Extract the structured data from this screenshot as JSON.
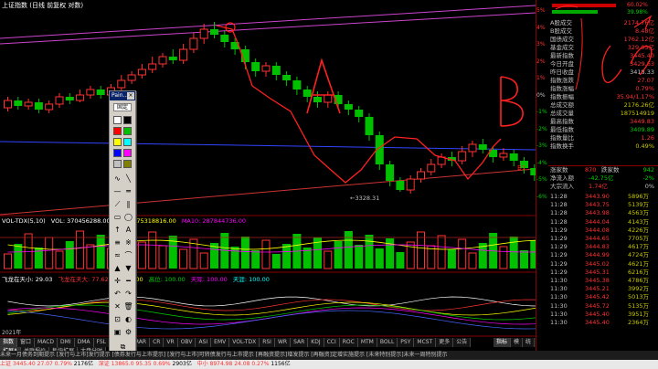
{
  "chart": {
    "title": "上证指数 (日线 前复权 对数)",
    "low_annotation": "←3328.31",
    "vol_legend": {
      "name": "VOL-TDX(5,10)",
      "vol": "VOL: 370456288.00",
      "ma5": "MA5: 275318816.00",
      "ma10": "MA10: 287844736.00"
    },
    "ind_legend": {
      "name": "飞龙在天",
      "a": "飞龙在天小: 29.03",
      "b": "飞龙在天大: 77.62",
      "c": "海底: 0.00",
      "d": "高位: 100.00",
      "e": "天际: 100.00",
      "f": "天涯: 100.00"
    },
    "date_label": "2021年"
  },
  "tabs_row1": [
    "指数",
    "窗口",
    "MACD",
    "DMI",
    "DMA",
    "FSL",
    "TRIX",
    "BRAR",
    "CR",
    "VR",
    "OBV",
    "ASI",
    "EMV",
    "VOL-TDX",
    "RSI",
    "WR",
    "SAR",
    "KDJ",
    "CCI",
    "ROC",
    "MTM",
    "BOLL",
    "PSY",
    "MCST",
    "更多",
    "公告"
  ],
  "tabs_row2": [
    "扩展A",
    "关联报价",
    "板块扩展",
    "大盘分时"
  ],
  "right_tabs": [
    "指标",
    "模",
    "统",
    "+"
  ],
  "percent_scale": [
    "5%",
    "4%",
    "3%",
    "2%",
    "1%",
    "0%",
    "-1%",
    "-2%",
    "-3%",
    "-4%",
    "-5%",
    "-6%"
  ],
  "top_bars": {
    "v1": "60.02%",
    "v2": "39.98%"
  },
  "market_stats": [
    {
      "label": "A股成交",
      "value": "2174.76亿",
      "color": "#ff3333"
    },
    {
      "label": "B股成交",
      "value": "8.48亿",
      "color": "#ff3333"
    },
    {
      "label": "国债成交",
      "value": "1762.12亿",
      "color": "#ff3333"
    },
    {
      "label": "基金成交",
      "value": "329.03亿",
      "color": "#ff3333"
    },
    {
      "label": "最新指数",
      "value": "3445.40",
      "color": "#ff3333"
    },
    {
      "label": "今日开盘",
      "value": "3429.63",
      "color": "#ff3333"
    },
    {
      "label": "昨日收盘",
      "value": "3418.33",
      "color": "#c0c0c0"
    },
    {
      "label": "指数涨跌",
      "value": "27.07",
      "color": "#ff3333"
    },
    {
      "label": "指数涨幅",
      "value": "0.79%",
      "color": "#ff3333"
    },
    {
      "label": "指数振幅",
      "value": "35.94/1.17%",
      "color": "#ff3333"
    },
    {
      "label": "总成交额",
      "value": "2176.26亿",
      "color": "#c8c800"
    },
    {
      "label": "总成交量",
      "value": "187514919",
      "color": "#c8c800"
    },
    {
      "label": "最高指数",
      "value": "3449.83",
      "color": "#ff3333"
    },
    {
      "label": "最低指数",
      "value": "3409.89",
      "color": "#00d000"
    },
    {
      "label": "指数量比",
      "value": "1.26",
      "color": "#ff3333"
    },
    {
      "label": "指数换手",
      "value": "0.49%",
      "color": "#c8c800"
    }
  ],
  "updown": {
    "up_label": "涨家数",
    "up": "870",
    "down_label": "跌家数",
    "down": "942"
  },
  "flow": [
    {
      "label": "净流入额",
      "value": "-42.75亿",
      "pct": "-2%"
    },
    {
      "label": "大宗流入",
      "value": "1.74亿",
      "pct": "0%"
    }
  ],
  "ticks": [
    {
      "t": "11:28",
      "p": "3443.90",
      "v": "5896万"
    },
    {
      "t": "11:28",
      "p": "3443.75",
      "v": "5139万"
    },
    {
      "t": "11:28",
      "p": "3443.98",
      "v": "4563万"
    },
    {
      "t": "11:28",
      "p": "3444.04",
      "v": "4143万"
    },
    {
      "t": "11:29",
      "p": "3444.08",
      "v": "4226万"
    },
    {
      "t": "11:29",
      "p": "3444.65",
      "v": "7705万"
    },
    {
      "t": "11:29",
      "p": "3444.83",
      "v": "4617万"
    },
    {
      "t": "11:29",
      "p": "3444.99",
      "v": "4724万"
    },
    {
      "t": "11:29",
      "p": "3445.02",
      "v": "4621万"
    },
    {
      "t": "11:29",
      "p": "3445.31",
      "v": "6216万"
    },
    {
      "t": "11:30",
      "p": "3445.38",
      "v": "4786万"
    },
    {
      "t": "11:30",
      "p": "3445.21",
      "v": "3992万"
    },
    {
      "t": "11:30",
      "p": "3445.42",
      "v": "5013万"
    },
    {
      "t": "11:30",
      "p": "3445.72",
      "v": "5135万"
    },
    {
      "t": "11:30",
      "p": "3445.40",
      "v": "3951万"
    },
    {
      "t": "11:30",
      "p": "3445.40",
      "v": "2364万"
    }
  ],
  "paint_box": {
    "title": "Pain...",
    "mode_label": "固定"
  },
  "ticker": "未来一月债务到期提示  [发行与上市]发行提示  [债券发行与上市提示]  [发行与上市]可转债发行与上市提示  [再融资提示]增发提示  [再融资]定增实施提示  [未来特别提示]未来一周特别提示",
  "status": {
    "sh_label": "上证",
    "sh": "3445.40",
    "sh_chg": "27.07",
    "sh_pct": "0.79%",
    "sh_amt": "2176亿",
    "sz_label": "深证",
    "sz": "13865.0",
    "sz_chg": "95.35",
    "sz_pct": "0.69%",
    "sz_amt": "2903亿",
    "zx_label": "中小",
    "zx": "8974.98",
    "zx_chg": "24.08",
    "zx_pct": "0.27%",
    "zx_amt": "1156亿"
  },
  "annotations": {
    "a": "A",
    "b": "B",
    "b1": "B1"
  }
}
